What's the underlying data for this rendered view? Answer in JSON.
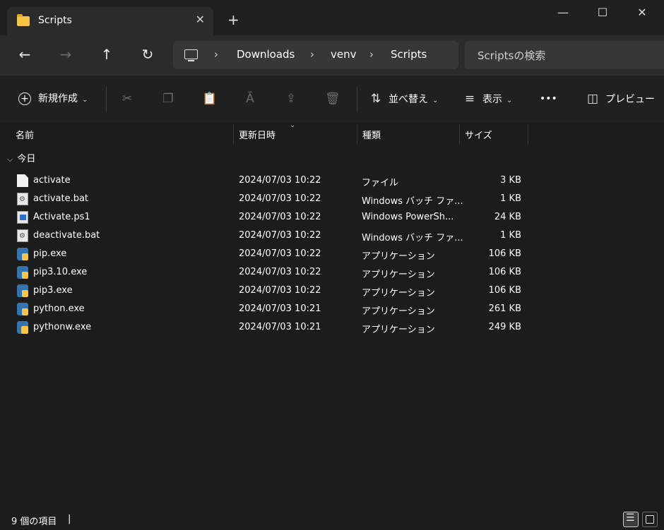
{
  "window": {
    "tab_title": "Scripts",
    "tab_close": "✕",
    "new_tab": "+",
    "minimize": "—",
    "maximize": "☐",
    "close": "✕"
  },
  "nav": {
    "back": "←",
    "forward": "→",
    "up": "↑",
    "refresh": "↻",
    "breadcrumb": [
      "Downloads",
      "venv",
      "Scripts"
    ],
    "separator": "›",
    "search_placeholder": "Scriptsの検索"
  },
  "toolbar": {
    "new_label": "新規作成",
    "new_icon": "plus-circle-icon",
    "sort_label": "並べ替え",
    "view_label": "表示",
    "more_label": "•••",
    "preview_label": "プレビュー",
    "chevron": "⌄"
  },
  "columns": {
    "name": "名前",
    "date": "更新日時",
    "type": "種類",
    "size": "サイズ"
  },
  "group": {
    "label": "今日",
    "chevron": "⌵"
  },
  "files": [
    {
      "name": "activate",
      "date": "2024/07/03 10:22",
      "type": "ファイル",
      "size": "3 KB",
      "icon": "file-icon"
    },
    {
      "name": "activate.bat",
      "date": "2024/07/03 10:22",
      "type": "Windows バッチ ファ...",
      "size": "1 KB",
      "icon": "batch-file-icon"
    },
    {
      "name": "Activate.ps1",
      "date": "2024/07/03 10:22",
      "type": "Windows PowerSh...",
      "size": "24 KB",
      "icon": "powershell-file-icon"
    },
    {
      "name": "deactivate.bat",
      "date": "2024/07/03 10:22",
      "type": "Windows バッチ ファ...",
      "size": "1 KB",
      "icon": "batch-file-icon"
    },
    {
      "name": "pip.exe",
      "date": "2024/07/03 10:22",
      "type": "アプリケーション",
      "size": "106 KB",
      "icon": "python-exe-icon"
    },
    {
      "name": "pip3.10.exe",
      "date": "2024/07/03 10:22",
      "type": "アプリケーション",
      "size": "106 KB",
      "icon": "python-exe-icon"
    },
    {
      "name": "pip3.exe",
      "date": "2024/07/03 10:22",
      "type": "アプリケーション",
      "size": "106 KB",
      "icon": "python-exe-icon"
    },
    {
      "name": "python.exe",
      "date": "2024/07/03 10:21",
      "type": "アプリケーション",
      "size": "261 KB",
      "icon": "python-exe-icon"
    },
    {
      "name": "pythonw.exe",
      "date": "2024/07/03 10:21",
      "type": "アプリケーション",
      "size": "249 KB",
      "icon": "pythonw-exe-icon"
    }
  ],
  "status": {
    "count": "9 個の項目",
    "cursor": "|"
  }
}
